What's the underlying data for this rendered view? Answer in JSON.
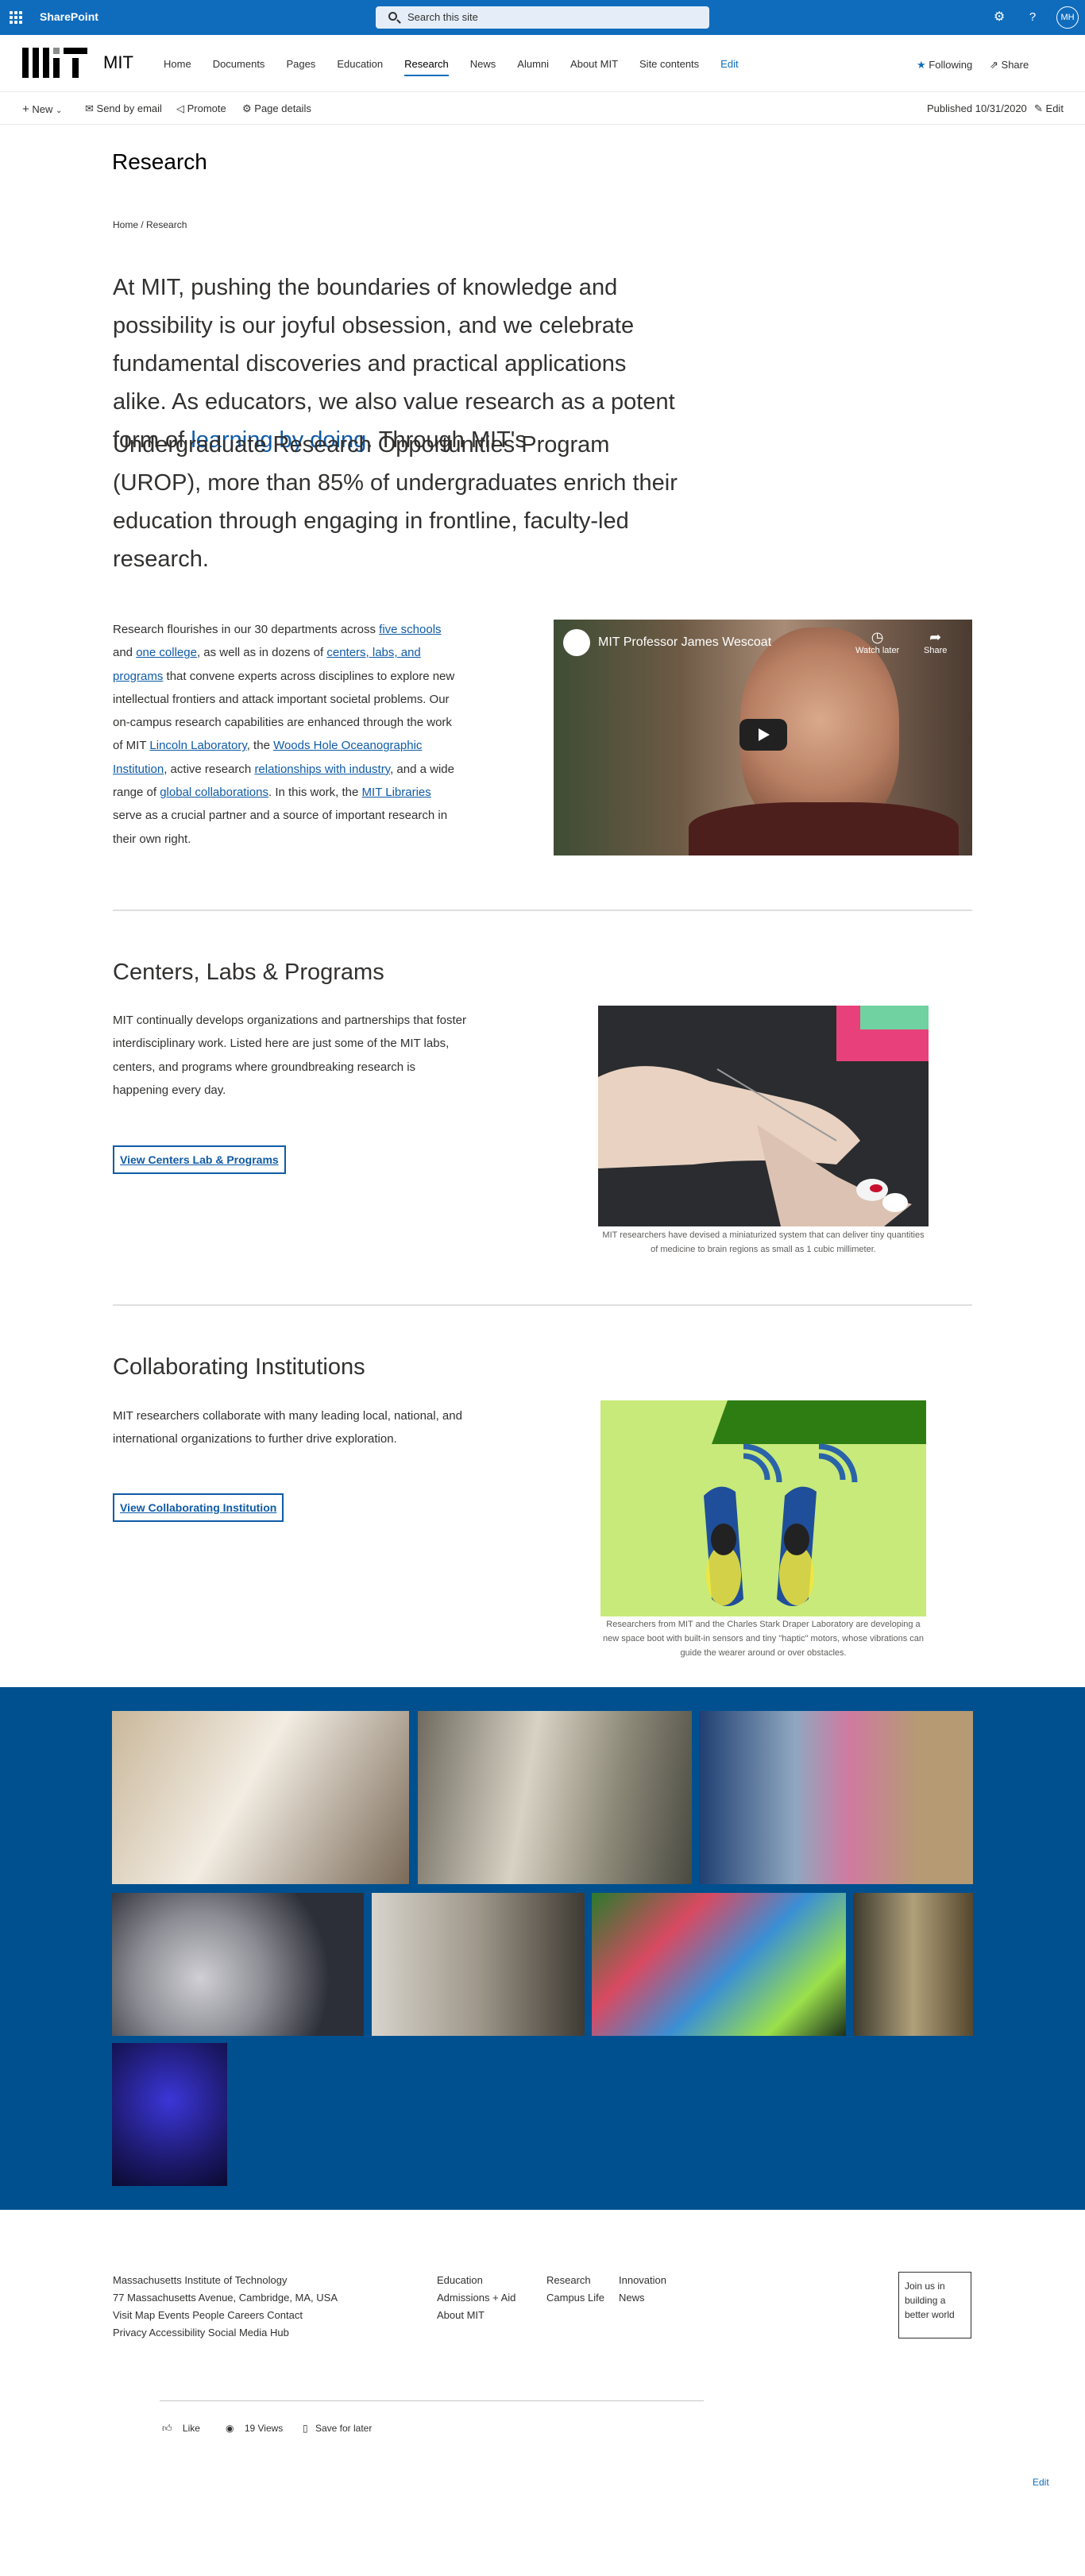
{
  "suitebar": {
    "app_name": "SharePoint",
    "search_placeholder": "Search this site",
    "avatar_initials": "MH"
  },
  "site": {
    "title": "MIT",
    "nav": [
      "Home",
      "Documents",
      "Pages",
      "Education",
      "Research",
      "News",
      "Alumni",
      "About MIT",
      "Site contents",
      "Edit"
    ],
    "active_nav": "Research",
    "following_label": "Following",
    "share_label": "Share"
  },
  "commandbar": {
    "new_label": "New",
    "send_label": "Send by email",
    "promote_label": "Promote",
    "details_label": "Page details",
    "published": "Published 10/31/2020",
    "edit_label": "Edit"
  },
  "page": {
    "title": "Research",
    "breadcrumb": "Home / Research",
    "lead_part1": "At MIT, pushing the boundaries of knowledge and possibility is our joyful obsession, and we celebrate fundamental discoveries and practical applications alike. As educators, we also value research as a potent form of ",
    "lead_link": "learning by doing",
    "lead_part2": ". Through MIT's",
    "lead_part3": "Undergraduate Research Opportunities Program (UROP), more than 85% of undergraduates enrich their education through engaging in frontline, faculty-led research.",
    "body": {
      "t1": "Research flourishes in our 30 departments across ",
      "l1": "five schools",
      "t2": " and ",
      "l2": "one college",
      "t3": ", as well as in dozens of ",
      "l3": "centers, labs, and programs",
      "t4": " that convene experts across disciplines to explore new intellectual frontiers and attack important societal problems. Our on-campus research capabilities are enhanced through the work of MIT ",
      "l4": "Lincoln Laboratory",
      "t5": ", the ",
      "l5": "Woods Hole Oceanographic Institution",
      "t6": ", active research ",
      "l6": "relationships with industry",
      "t7": ", and a wide range of ",
      "l7": "global collaborations",
      "t8": ". In this work, the ",
      "l8": "MIT Libraries",
      "t9": " serve as a crucial partner and a source of important research in their own right."
    },
    "video": {
      "title": "MIT Professor James Wescoat",
      "watch_later": "Watch later",
      "share": "Share"
    }
  },
  "centers": {
    "heading": "Centers, Labs & Programs",
    "text": "MIT continually develops organizations and partnerships that foster interdisciplinary work. Listed here are just some of the MIT labs, centers, and programs where groundbreaking research is happening every day.",
    "button": "View Centers Lab & Programs",
    "caption": "MIT researchers have devised a miniaturized system that can deliver tiny quantities of medicine to brain regions as small as 1 cubic millimeter."
  },
  "collab": {
    "heading": "Collaborating Institutions",
    "text": "MIT researchers collaborate with many leading local, national, and international organizations to further drive exploration.",
    "button": "View Collaborating Institution",
    "caption": "Researchers from MIT and the Charles Stark Draper Laboratory are developing a new space boot with built-in sensors and tiny \"haptic\" motors, whose vibrations can guide the wearer around or over obstacles."
  },
  "footer": {
    "address_lines": [
      "Massachusetts Institute of Technology",
      "77 Massachusetts Avenue, Cambridge, MA, USA",
      "Visit Map Events People Careers Contact",
      "Privacy Accessibility Social Media Hub"
    ],
    "col2": [
      "Education",
      "Admissions + Aid",
      "About MIT"
    ],
    "col3": [
      "Research",
      "Campus Life"
    ],
    "col4": [
      "Innovation",
      "News"
    ],
    "join": "Join us in building a better world"
  },
  "social": {
    "like": "Like",
    "views": "19 Views",
    "save": "Save for later",
    "edit": "Edit"
  },
  "colors": {
    "suitebar": "#0f6cbd",
    "gallery_bg": "#00508f",
    "link": "#0f5ba7"
  }
}
